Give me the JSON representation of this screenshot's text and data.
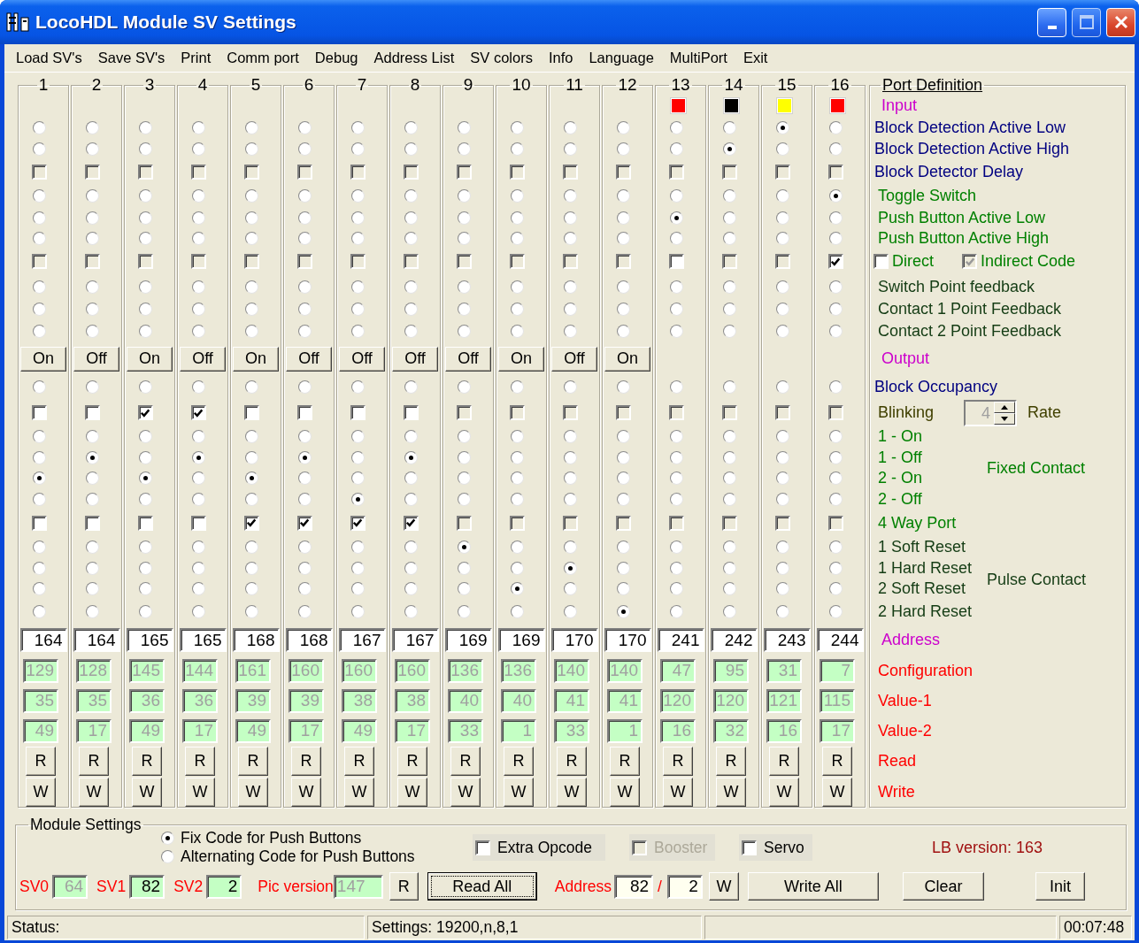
{
  "window": {
    "title": "LocoHDL Module SV Settings"
  },
  "menu": [
    "Load SV's",
    "Save SV's",
    "Print",
    "Comm port",
    "Debug",
    "Address List",
    "SV colors",
    "Info",
    "Language",
    "MultiPort",
    "Exit"
  ],
  "columns": [
    {
      "number": "1",
      "toggle": "On",
      "address": "164",
      "configuration": "129",
      "value_1": "35",
      "value_2": "49",
      "read": "R",
      "write": "W",
      "options": [
        {
          "kind": "radio",
          "selected": false
        },
        {
          "kind": "radio",
          "selected": false
        },
        {
          "kind": "check",
          "checked": false,
          "disabled": true
        },
        {
          "kind": "radio",
          "selected": false
        },
        {
          "kind": "radio",
          "selected": false
        },
        {
          "kind": "radio",
          "selected": false
        },
        {
          "kind": "check",
          "checked": false,
          "disabled": true
        },
        {
          "kind": "radio",
          "selected": false
        },
        {
          "kind": "radio",
          "selected": false
        },
        {
          "kind": "radio",
          "selected": false
        },
        {
          "kind": "radio",
          "selected": false
        },
        {
          "kind": "check",
          "checked": false,
          "disabled": false
        },
        {
          "kind": "radio",
          "selected": false
        },
        {
          "kind": "radio",
          "selected": false
        },
        {
          "kind": "radio",
          "selected": true
        },
        {
          "kind": "radio",
          "selected": false
        },
        {
          "kind": "check",
          "checked": false,
          "disabled": false
        },
        {
          "kind": "radio",
          "selected": false
        },
        {
          "kind": "radio",
          "selected": false
        },
        {
          "kind": "radio",
          "selected": false
        },
        {
          "kind": "radio",
          "selected": false
        }
      ]
    },
    {
      "number": "2",
      "toggle": "Off",
      "address": "164",
      "configuration": "128",
      "value_1": "35",
      "value_2": "17",
      "read": "R",
      "write": "W",
      "options": [
        {
          "kind": "radio",
          "selected": false
        },
        {
          "kind": "radio",
          "selected": false
        },
        {
          "kind": "check",
          "checked": false,
          "disabled": true
        },
        {
          "kind": "radio",
          "selected": false
        },
        {
          "kind": "radio",
          "selected": false
        },
        {
          "kind": "radio",
          "selected": false
        },
        {
          "kind": "check",
          "checked": false,
          "disabled": true
        },
        {
          "kind": "radio",
          "selected": false
        },
        {
          "kind": "radio",
          "selected": false
        },
        {
          "kind": "radio",
          "selected": false
        },
        {
          "kind": "radio",
          "selected": false
        },
        {
          "kind": "check",
          "checked": false,
          "disabled": false
        },
        {
          "kind": "radio",
          "selected": false
        },
        {
          "kind": "radio",
          "selected": true
        },
        {
          "kind": "radio",
          "selected": false
        },
        {
          "kind": "radio",
          "selected": false
        },
        {
          "kind": "check",
          "checked": false,
          "disabled": false
        },
        {
          "kind": "radio",
          "selected": false
        },
        {
          "kind": "radio",
          "selected": false
        },
        {
          "kind": "radio",
          "selected": false
        },
        {
          "kind": "radio",
          "selected": false
        }
      ]
    },
    {
      "number": "3",
      "toggle": "On",
      "address": "165",
      "configuration": "145",
      "value_1": "36",
      "value_2": "49",
      "read": "R",
      "write": "W",
      "options": [
        {
          "kind": "radio",
          "selected": false
        },
        {
          "kind": "radio",
          "selected": false
        },
        {
          "kind": "check",
          "checked": false,
          "disabled": true
        },
        {
          "kind": "radio",
          "selected": false
        },
        {
          "kind": "radio",
          "selected": false
        },
        {
          "kind": "radio",
          "selected": false
        },
        {
          "kind": "check",
          "checked": false,
          "disabled": true
        },
        {
          "kind": "radio",
          "selected": false
        },
        {
          "kind": "radio",
          "selected": false
        },
        {
          "kind": "radio",
          "selected": false
        },
        {
          "kind": "radio",
          "selected": false
        },
        {
          "kind": "check",
          "checked": true,
          "disabled": false
        },
        {
          "kind": "radio",
          "selected": false
        },
        {
          "kind": "radio",
          "selected": false
        },
        {
          "kind": "radio",
          "selected": true
        },
        {
          "kind": "radio",
          "selected": false
        },
        {
          "kind": "check",
          "checked": false,
          "disabled": false
        },
        {
          "kind": "radio",
          "selected": false
        },
        {
          "kind": "radio",
          "selected": false
        },
        {
          "kind": "radio",
          "selected": false
        },
        {
          "kind": "radio",
          "selected": false
        }
      ]
    },
    {
      "number": "4",
      "toggle": "Off",
      "address": "165",
      "configuration": "144",
      "value_1": "36",
      "value_2": "17",
      "read": "R",
      "write": "W",
      "options": [
        {
          "kind": "radio",
          "selected": false
        },
        {
          "kind": "radio",
          "selected": false
        },
        {
          "kind": "check",
          "checked": false,
          "disabled": true
        },
        {
          "kind": "radio",
          "selected": false
        },
        {
          "kind": "radio",
          "selected": false
        },
        {
          "kind": "radio",
          "selected": false
        },
        {
          "kind": "check",
          "checked": false,
          "disabled": true
        },
        {
          "kind": "radio",
          "selected": false
        },
        {
          "kind": "radio",
          "selected": false
        },
        {
          "kind": "radio",
          "selected": false
        },
        {
          "kind": "radio",
          "selected": false
        },
        {
          "kind": "check",
          "checked": true,
          "disabled": false
        },
        {
          "kind": "radio",
          "selected": false
        },
        {
          "kind": "radio",
          "selected": true
        },
        {
          "kind": "radio",
          "selected": false
        },
        {
          "kind": "radio",
          "selected": false
        },
        {
          "kind": "check",
          "checked": false,
          "disabled": false
        },
        {
          "kind": "radio",
          "selected": false
        },
        {
          "kind": "radio",
          "selected": false
        },
        {
          "kind": "radio",
          "selected": false
        },
        {
          "kind": "radio",
          "selected": false
        }
      ]
    },
    {
      "number": "5",
      "toggle": "On",
      "address": "168",
      "configuration": "161",
      "value_1": "39",
      "value_2": "49",
      "read": "R",
      "write": "W",
      "options": [
        {
          "kind": "radio",
          "selected": false
        },
        {
          "kind": "radio",
          "selected": false
        },
        {
          "kind": "check",
          "checked": false,
          "disabled": true
        },
        {
          "kind": "radio",
          "selected": false
        },
        {
          "kind": "radio",
          "selected": false
        },
        {
          "kind": "radio",
          "selected": false
        },
        {
          "kind": "check",
          "checked": false,
          "disabled": true
        },
        {
          "kind": "radio",
          "selected": false
        },
        {
          "kind": "radio",
          "selected": false
        },
        {
          "kind": "radio",
          "selected": false
        },
        {
          "kind": "radio",
          "selected": false
        },
        {
          "kind": "check",
          "checked": false,
          "disabled": false
        },
        {
          "kind": "radio",
          "selected": false
        },
        {
          "kind": "radio",
          "selected": false
        },
        {
          "kind": "radio",
          "selected": true
        },
        {
          "kind": "radio",
          "selected": false
        },
        {
          "kind": "check",
          "checked": true,
          "disabled": false
        },
        {
          "kind": "radio",
          "selected": false
        },
        {
          "kind": "radio",
          "selected": false
        },
        {
          "kind": "radio",
          "selected": false
        },
        {
          "kind": "radio",
          "selected": false
        }
      ]
    },
    {
      "number": "6",
      "toggle": "Off",
      "address": "168",
      "configuration": "160",
      "value_1": "39",
      "value_2": "17",
      "read": "R",
      "write": "W",
      "options": [
        {
          "kind": "radio",
          "selected": false
        },
        {
          "kind": "radio",
          "selected": false
        },
        {
          "kind": "check",
          "checked": false,
          "disabled": true
        },
        {
          "kind": "radio",
          "selected": false
        },
        {
          "kind": "radio",
          "selected": false
        },
        {
          "kind": "radio",
          "selected": false
        },
        {
          "kind": "check",
          "checked": false,
          "disabled": true
        },
        {
          "kind": "radio",
          "selected": false
        },
        {
          "kind": "radio",
          "selected": false
        },
        {
          "kind": "radio",
          "selected": false
        },
        {
          "kind": "radio",
          "selected": false
        },
        {
          "kind": "check",
          "checked": false,
          "disabled": false
        },
        {
          "kind": "radio",
          "selected": false
        },
        {
          "kind": "radio",
          "selected": true
        },
        {
          "kind": "radio",
          "selected": false
        },
        {
          "kind": "radio",
          "selected": false
        },
        {
          "kind": "check",
          "checked": true,
          "disabled": false
        },
        {
          "kind": "radio",
          "selected": false
        },
        {
          "kind": "radio",
          "selected": false
        },
        {
          "kind": "radio",
          "selected": false
        },
        {
          "kind": "radio",
          "selected": false
        }
      ]
    },
    {
      "number": "7",
      "toggle": "Off",
      "address": "167",
      "configuration": "160",
      "value_1": "38",
      "value_2": "49",
      "read": "R",
      "write": "W",
      "options": [
        {
          "kind": "radio",
          "selected": false
        },
        {
          "kind": "radio",
          "selected": false
        },
        {
          "kind": "check",
          "checked": false,
          "disabled": true
        },
        {
          "kind": "radio",
          "selected": false
        },
        {
          "kind": "radio",
          "selected": false
        },
        {
          "kind": "radio",
          "selected": false
        },
        {
          "kind": "check",
          "checked": false,
          "disabled": true
        },
        {
          "kind": "radio",
          "selected": false
        },
        {
          "kind": "radio",
          "selected": false
        },
        {
          "kind": "radio",
          "selected": false
        },
        {
          "kind": "radio",
          "selected": false
        },
        {
          "kind": "check",
          "checked": false,
          "disabled": false
        },
        {
          "kind": "radio",
          "selected": false
        },
        {
          "kind": "radio",
          "selected": false
        },
        {
          "kind": "radio",
          "selected": false
        },
        {
          "kind": "radio",
          "selected": true
        },
        {
          "kind": "check",
          "checked": true,
          "disabled": false
        },
        {
          "kind": "radio",
          "selected": false
        },
        {
          "kind": "radio",
          "selected": false
        },
        {
          "kind": "radio",
          "selected": false
        },
        {
          "kind": "radio",
          "selected": false
        }
      ]
    },
    {
      "number": "8",
      "toggle": "Off",
      "address": "167",
      "configuration": "160",
      "value_1": "38",
      "value_2": "17",
      "read": "R",
      "write": "W",
      "options": [
        {
          "kind": "radio",
          "selected": false
        },
        {
          "kind": "radio",
          "selected": false
        },
        {
          "kind": "check",
          "checked": false,
          "disabled": true
        },
        {
          "kind": "radio",
          "selected": false
        },
        {
          "kind": "radio",
          "selected": false
        },
        {
          "kind": "radio",
          "selected": false
        },
        {
          "kind": "check",
          "checked": false,
          "disabled": true
        },
        {
          "kind": "radio",
          "selected": false
        },
        {
          "kind": "radio",
          "selected": false
        },
        {
          "kind": "radio",
          "selected": false
        },
        {
          "kind": "radio",
          "selected": false
        },
        {
          "kind": "check",
          "checked": false,
          "disabled": false
        },
        {
          "kind": "radio",
          "selected": false
        },
        {
          "kind": "radio",
          "selected": true
        },
        {
          "kind": "radio",
          "selected": false
        },
        {
          "kind": "radio",
          "selected": false
        },
        {
          "kind": "check",
          "checked": true,
          "disabled": false
        },
        {
          "kind": "radio",
          "selected": false
        },
        {
          "kind": "radio",
          "selected": false
        },
        {
          "kind": "radio",
          "selected": false
        },
        {
          "kind": "radio",
          "selected": false
        }
      ]
    },
    {
      "number": "9",
      "toggle": "Off",
      "address": "169",
      "configuration": "136",
      "value_1": "40",
      "value_2": "33",
      "read": "R",
      "write": "W",
      "options": [
        {
          "kind": "radio",
          "selected": false
        },
        {
          "kind": "radio",
          "selected": false
        },
        {
          "kind": "check",
          "checked": false,
          "disabled": true
        },
        {
          "kind": "radio",
          "selected": false
        },
        {
          "kind": "radio",
          "selected": false
        },
        {
          "kind": "radio",
          "selected": false
        },
        {
          "kind": "check",
          "checked": false,
          "disabled": true
        },
        {
          "kind": "radio",
          "selected": false
        },
        {
          "kind": "radio",
          "selected": false
        },
        {
          "kind": "radio",
          "selected": false
        },
        {
          "kind": "radio",
          "selected": false
        },
        {
          "kind": "check",
          "checked": false,
          "disabled": true
        },
        {
          "kind": "radio",
          "selected": false
        },
        {
          "kind": "radio",
          "selected": false
        },
        {
          "kind": "radio",
          "selected": false
        },
        {
          "kind": "radio",
          "selected": false
        },
        {
          "kind": "check",
          "checked": false,
          "disabled": true
        },
        {
          "kind": "radio",
          "selected": true
        },
        {
          "kind": "radio",
          "selected": false
        },
        {
          "kind": "radio",
          "selected": false
        },
        {
          "kind": "radio",
          "selected": false
        }
      ]
    },
    {
      "number": "10",
      "toggle": "On",
      "address": "169",
      "configuration": "136",
      "value_1": "40",
      "value_2": "1",
      "read": "R",
      "write": "W",
      "options": [
        {
          "kind": "radio",
          "selected": false
        },
        {
          "kind": "radio",
          "selected": false
        },
        {
          "kind": "check",
          "checked": false,
          "disabled": true
        },
        {
          "kind": "radio",
          "selected": false
        },
        {
          "kind": "radio",
          "selected": false
        },
        {
          "kind": "radio",
          "selected": false
        },
        {
          "kind": "check",
          "checked": false,
          "disabled": true
        },
        {
          "kind": "radio",
          "selected": false
        },
        {
          "kind": "radio",
          "selected": false
        },
        {
          "kind": "radio",
          "selected": false
        },
        {
          "kind": "radio",
          "selected": false
        },
        {
          "kind": "check",
          "checked": false,
          "disabled": true
        },
        {
          "kind": "radio",
          "selected": false
        },
        {
          "kind": "radio",
          "selected": false
        },
        {
          "kind": "radio",
          "selected": false
        },
        {
          "kind": "radio",
          "selected": false
        },
        {
          "kind": "check",
          "checked": false,
          "disabled": true
        },
        {
          "kind": "radio",
          "selected": false
        },
        {
          "kind": "radio",
          "selected": false
        },
        {
          "kind": "radio",
          "selected": true
        },
        {
          "kind": "radio",
          "selected": false
        }
      ]
    },
    {
      "number": "11",
      "toggle": "Off",
      "address": "170",
      "configuration": "140",
      "value_1": "41",
      "value_2": "33",
      "read": "R",
      "write": "W",
      "options": [
        {
          "kind": "radio",
          "selected": false
        },
        {
          "kind": "radio",
          "selected": false
        },
        {
          "kind": "check",
          "checked": false,
          "disabled": true
        },
        {
          "kind": "radio",
          "selected": false
        },
        {
          "kind": "radio",
          "selected": false
        },
        {
          "kind": "radio",
          "selected": false
        },
        {
          "kind": "check",
          "checked": false,
          "disabled": true
        },
        {
          "kind": "radio",
          "selected": false
        },
        {
          "kind": "radio",
          "selected": false
        },
        {
          "kind": "radio",
          "selected": false
        },
        {
          "kind": "radio",
          "selected": false
        },
        {
          "kind": "check",
          "checked": false,
          "disabled": true
        },
        {
          "kind": "radio",
          "selected": false
        },
        {
          "kind": "radio",
          "selected": false
        },
        {
          "kind": "radio",
          "selected": false
        },
        {
          "kind": "radio",
          "selected": false
        },
        {
          "kind": "check",
          "checked": false,
          "disabled": true
        },
        {
          "kind": "radio",
          "selected": false
        },
        {
          "kind": "radio",
          "selected": true
        },
        {
          "kind": "radio",
          "selected": false
        },
        {
          "kind": "radio",
          "selected": false
        }
      ]
    },
    {
      "number": "12",
      "toggle": "On",
      "address": "170",
      "configuration": "140",
      "value_1": "41",
      "value_2": "1",
      "read": "R",
      "write": "W",
      "options": [
        {
          "kind": "radio",
          "selected": false
        },
        {
          "kind": "radio",
          "selected": false
        },
        {
          "kind": "check",
          "checked": false,
          "disabled": true
        },
        {
          "kind": "radio",
          "selected": false
        },
        {
          "kind": "radio",
          "selected": false
        },
        {
          "kind": "radio",
          "selected": false
        },
        {
          "kind": "check",
          "checked": false,
          "disabled": true
        },
        {
          "kind": "radio",
          "selected": false
        },
        {
          "kind": "radio",
          "selected": false
        },
        {
          "kind": "radio",
          "selected": false
        },
        {
          "kind": "radio",
          "selected": false
        },
        {
          "kind": "check",
          "checked": false,
          "disabled": true
        },
        {
          "kind": "radio",
          "selected": false
        },
        {
          "kind": "radio",
          "selected": false
        },
        {
          "kind": "radio",
          "selected": false
        },
        {
          "kind": "radio",
          "selected": false
        },
        {
          "kind": "check",
          "checked": false,
          "disabled": true
        },
        {
          "kind": "radio",
          "selected": false
        },
        {
          "kind": "radio",
          "selected": false
        },
        {
          "kind": "radio",
          "selected": false
        },
        {
          "kind": "radio",
          "selected": true
        }
      ]
    },
    {
      "number": "13",
      "color": "#ff0000",
      "address": "241",
      "configuration": "47",
      "value_1": "120",
      "value_2": "16",
      "read": "R",
      "write": "W",
      "options": [
        {
          "kind": "radio",
          "selected": false
        },
        {
          "kind": "radio",
          "selected": false
        },
        {
          "kind": "check",
          "checked": false,
          "disabled": true
        },
        {
          "kind": "radio",
          "selected": false
        },
        {
          "kind": "radio",
          "selected": true
        },
        {
          "kind": "radio",
          "selected": false
        },
        {
          "kind": "check",
          "checked": false,
          "disabled": false
        },
        {
          "kind": "radio",
          "selected": false
        },
        {
          "kind": "radio",
          "selected": false
        },
        {
          "kind": "radio",
          "selected": false
        },
        {
          "kind": "radio",
          "selected": false
        },
        {
          "kind": "check",
          "checked": false,
          "disabled": true
        },
        {
          "kind": "radio",
          "selected": false
        },
        {
          "kind": "radio",
          "selected": false
        },
        {
          "kind": "radio",
          "selected": false
        },
        {
          "kind": "radio",
          "selected": false
        },
        {
          "kind": "check",
          "checked": false,
          "disabled": true
        },
        {
          "kind": "radio",
          "selected": false
        },
        {
          "kind": "radio",
          "selected": false
        },
        {
          "kind": "radio",
          "selected": false
        },
        {
          "kind": "radio",
          "selected": false
        }
      ]
    },
    {
      "number": "14",
      "color": "#000000",
      "address": "242",
      "configuration": "95",
      "value_1": "120",
      "value_2": "32",
      "read": "R",
      "write": "W",
      "options": [
        {
          "kind": "radio",
          "selected": false
        },
        {
          "kind": "radio",
          "selected": true
        },
        {
          "kind": "check",
          "checked": false,
          "disabled": true
        },
        {
          "kind": "radio",
          "selected": false
        },
        {
          "kind": "radio",
          "selected": false
        },
        {
          "kind": "radio",
          "selected": false
        },
        {
          "kind": "check",
          "checked": false,
          "disabled": true
        },
        {
          "kind": "radio",
          "selected": false
        },
        {
          "kind": "radio",
          "selected": false
        },
        {
          "kind": "radio",
          "selected": false
        },
        {
          "kind": "radio",
          "selected": false
        },
        {
          "kind": "check",
          "checked": false,
          "disabled": true
        },
        {
          "kind": "radio",
          "selected": false
        },
        {
          "kind": "radio",
          "selected": false
        },
        {
          "kind": "radio",
          "selected": false
        },
        {
          "kind": "radio",
          "selected": false
        },
        {
          "kind": "check",
          "checked": false,
          "disabled": true
        },
        {
          "kind": "radio",
          "selected": false
        },
        {
          "kind": "radio",
          "selected": false
        },
        {
          "kind": "radio",
          "selected": false
        },
        {
          "kind": "radio",
          "selected": false
        }
      ]
    },
    {
      "number": "15",
      "color": "#ffff00",
      "address": "243",
      "configuration": "31",
      "value_1": "121",
      "value_2": "16",
      "read": "R",
      "write": "W",
      "options": [
        {
          "kind": "radio",
          "selected": true
        },
        {
          "kind": "radio",
          "selected": false
        },
        {
          "kind": "check",
          "checked": false,
          "disabled": true
        },
        {
          "kind": "radio",
          "selected": false
        },
        {
          "kind": "radio",
          "selected": false
        },
        {
          "kind": "radio",
          "selected": false
        },
        {
          "kind": "check",
          "checked": false,
          "disabled": true
        },
        {
          "kind": "radio",
          "selected": false
        },
        {
          "kind": "radio",
          "selected": false
        },
        {
          "kind": "radio",
          "selected": false
        },
        {
          "kind": "radio",
          "selected": false
        },
        {
          "kind": "check",
          "checked": false,
          "disabled": true
        },
        {
          "kind": "radio",
          "selected": false
        },
        {
          "kind": "radio",
          "selected": false
        },
        {
          "kind": "radio",
          "selected": false
        },
        {
          "kind": "radio",
          "selected": false
        },
        {
          "kind": "check",
          "checked": false,
          "disabled": true
        },
        {
          "kind": "radio",
          "selected": false
        },
        {
          "kind": "radio",
          "selected": false
        },
        {
          "kind": "radio",
          "selected": false
        },
        {
          "kind": "radio",
          "selected": false
        }
      ]
    },
    {
      "number": "16",
      "color": "#ff0000",
      "address": "244",
      "configuration": "7",
      "value_1": "115",
      "value_2": "17",
      "read": "R",
      "write": "W",
      "options": [
        {
          "kind": "radio",
          "selected": false
        },
        {
          "kind": "radio",
          "selected": false
        },
        {
          "kind": "check",
          "checked": false,
          "disabled": true
        },
        {
          "kind": "radio",
          "selected": true
        },
        {
          "kind": "radio",
          "selected": false
        },
        {
          "kind": "radio",
          "selected": false
        },
        {
          "kind": "check",
          "checked": true,
          "disabled": false
        },
        {
          "kind": "radio",
          "selected": false
        },
        {
          "kind": "radio",
          "selected": false
        },
        {
          "kind": "radio",
          "selected": false
        },
        {
          "kind": "radio",
          "selected": false
        },
        {
          "kind": "check",
          "checked": false,
          "disabled": true
        },
        {
          "kind": "radio",
          "selected": false
        },
        {
          "kind": "radio",
          "selected": false
        },
        {
          "kind": "radio",
          "selected": false
        },
        {
          "kind": "radio",
          "selected": false
        },
        {
          "kind": "check",
          "checked": false,
          "disabled": true
        },
        {
          "kind": "radio",
          "selected": false
        },
        {
          "kind": "radio",
          "selected": false
        },
        {
          "kind": "radio",
          "selected": false
        },
        {
          "kind": "radio",
          "selected": false
        }
      ]
    }
  ],
  "port_definition": {
    "title": "Port Definition",
    "rows": [
      {
        "kind": "heading",
        "text": "Input"
      },
      {
        "kind": "detect",
        "text": "Block Detection Active Low"
      },
      {
        "kind": "detect",
        "text": "Block Detection Active High"
      },
      {
        "kind": "detect",
        "text": "Block Detector Delay"
      },
      {
        "kind": "switch",
        "text": "Toggle Switch"
      },
      {
        "kind": "switch",
        "text": "Push Button Active Low"
      },
      {
        "kind": "switch",
        "text": "Push Button Active High"
      },
      {
        "kind": "checks",
        "checks": [
          {
            "text": "Direct",
            "checked": false,
            "disabled": false
          },
          {
            "text": "Indirect Code",
            "checked": true,
            "disabled": true
          }
        ]
      },
      {
        "kind": "feedback",
        "text": "Switch Point feedback"
      },
      {
        "kind": "feedback",
        "text": "Contact 1 Point Feedback"
      },
      {
        "kind": "feedback",
        "text": "Contact 2 Point Feedback"
      },
      {
        "kind": "heading",
        "text": "Output"
      },
      {
        "kind": "detect",
        "text": "Block Occupancy"
      },
      {
        "kind": "spinner",
        "text": "Blinking",
        "value": "4",
        "unit": "Rate"
      },
      {
        "kind": "switch",
        "text": "1 - On",
        "side": "Fixed Contact"
      },
      {
        "kind": "switch",
        "text": "1 - Off"
      },
      {
        "kind": "switch",
        "text": "2 - On"
      },
      {
        "kind": "switch",
        "text": "2 - Off"
      },
      {
        "kind": "switch",
        "text": "4 Way Port"
      },
      {
        "kind": "feedback",
        "text": "1 Soft Reset",
        "side": "Pulse Contact"
      },
      {
        "kind": "feedback",
        "text": "1 Hard Reset"
      },
      {
        "kind": "feedback",
        "text": "2 Soft Reset"
      },
      {
        "kind": "feedback",
        "text": "2 Hard Reset"
      },
      {
        "kind": "heading",
        "text": "Address"
      },
      {
        "kind": "sv",
        "text": "Configuration"
      },
      {
        "kind": "sv",
        "text": "Value-1"
      },
      {
        "kind": "sv",
        "text": "Value-2"
      },
      {
        "kind": "sv",
        "text": "Read"
      },
      {
        "kind": "sv",
        "text": "Write"
      }
    ]
  },
  "module_settings": {
    "title": "Module Settings",
    "code_modes": [
      {
        "text": "Fix Code for Push Buttons",
        "selected": true
      },
      {
        "text": "Alternating Code for Push Buttons",
        "selected": false
      }
    ],
    "options": [
      {
        "text": "Extra Opcode",
        "checked": false,
        "disabled": false
      },
      {
        "text": "Booster",
        "checked": false,
        "disabled": true
      },
      {
        "text": "Servo",
        "checked": false,
        "disabled": false
      }
    ],
    "lb_version": "LB version: 163",
    "sv_fields": [
      {
        "label": "SV0",
        "value": "64",
        "disabled": true
      },
      {
        "label": "SV1",
        "value": "82",
        "disabled": false
      },
      {
        "label": "SV2",
        "value": "2",
        "disabled": false
      }
    ],
    "pic_version": {
      "label": "Pic version",
      "value": "147",
      "disabled": true
    },
    "read_button": "R",
    "read_all_button": "Read All",
    "address": {
      "label": "Address",
      "high": "82",
      "separator": "/",
      "low": "2"
    },
    "write_button": "W",
    "write_all_button": "Write All",
    "clear_button": "Clear",
    "init_button": "Init"
  },
  "status_bar": {
    "status": "Status:",
    "settings": "Settings: 19200,n,8,1",
    "time": "00:07:48"
  }
}
